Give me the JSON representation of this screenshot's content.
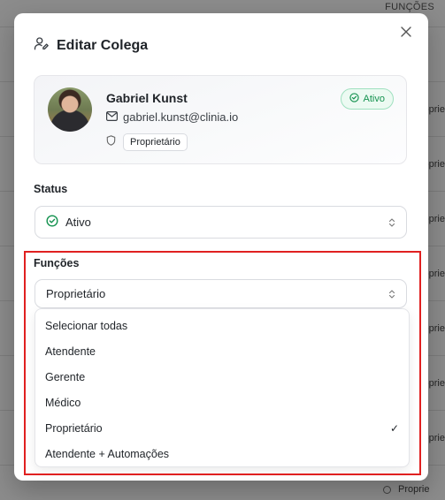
{
  "background": {
    "column_header": "FUNÇÕES",
    "cell_text": "Proprie",
    "bottom_text": "Proprie"
  },
  "modal": {
    "title": "Editar Colega",
    "close_icon": "x-icon",
    "title_icon": "user-edit-icon"
  },
  "profile": {
    "name": "Gabriel Kunst",
    "email": "gabriel.kunst@clinia.io",
    "role": "Proprietário",
    "status_badge": "Ativo",
    "colors": {
      "badge_text": "#14924f",
      "badge_bg": "#ecfaf2",
      "badge_border": "#9fe0bf"
    }
  },
  "status": {
    "label": "Status",
    "value": "Ativo"
  },
  "functions": {
    "label": "Funções",
    "selected_value": "Proprietário",
    "options": [
      {
        "label": "Selecionar todas",
        "checked": false
      },
      {
        "label": "Atendente",
        "checked": false
      },
      {
        "label": "Gerente",
        "checked": false
      },
      {
        "label": "Médico",
        "checked": false
      },
      {
        "label": "Proprietário",
        "checked": true
      },
      {
        "label": "Atendente + Automações",
        "checked": false
      }
    ],
    "check_mark": "✓"
  },
  "highlight_color": "#e02020"
}
